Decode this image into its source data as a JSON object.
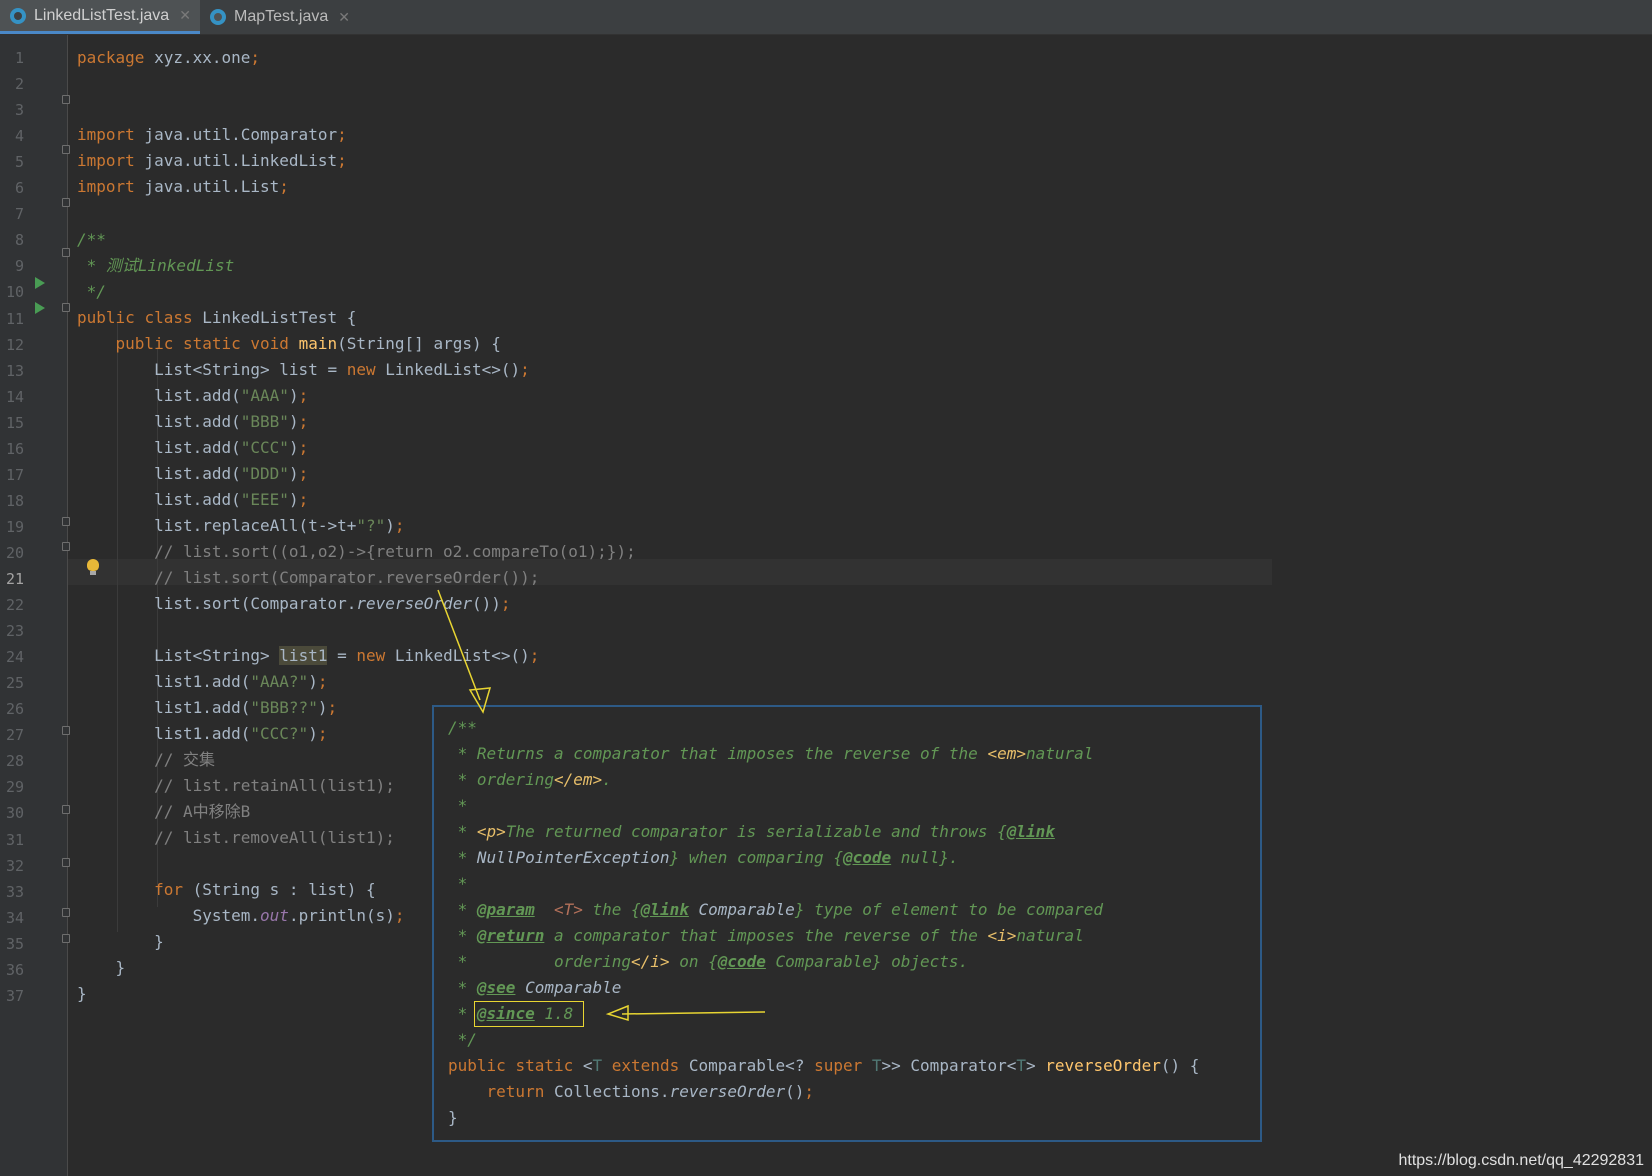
{
  "tabs": [
    {
      "label": "LinkedListTest.java",
      "active": true
    },
    {
      "label": "MapTest.java",
      "active": false
    }
  ],
  "current_line": 21,
  "line_numbers": [
    "1",
    "2",
    "3",
    "4",
    "5",
    "6",
    "7",
    "8",
    "9",
    "10",
    "11",
    "12",
    "13",
    "14",
    "15",
    "16",
    "17",
    "18",
    "19",
    "20",
    "21",
    "22",
    "23",
    "24",
    "25",
    "26",
    "27",
    "28",
    "29",
    "30",
    "31",
    "32",
    "33",
    "34",
    "35",
    "36",
    "37"
  ],
  "code": {
    "l1_kw": "package",
    "l1_rest": " xyz.xx.one",
    "semi": ";",
    "import_kw": "import",
    "l3": " java.util.Comparator",
    "l4": " java.util.LinkedList",
    "l5": " java.util.List",
    "l7": "/**",
    "l8": " * 测试LinkedList",
    "l9": " */",
    "public": "public",
    "class": "class",
    "static": "static",
    "void": "void",
    "l10_name": " LinkedListTest {",
    "main": "main",
    "l11_args": "(String[] args) {",
    "l12_a": "List<String> list = ",
    "new": "new",
    "l12_b": " LinkedList<>()",
    "add": "list.add(",
    "add1": "list1.add(",
    "s_aaa": "\"AAA\"",
    "s_bbb": "\"BBB\"",
    "s_ccc": "\"CCC\"",
    "s_ddd": "\"DDD\"",
    "s_eee": "\"EEE\"",
    "close": ")",
    "l18_a": "list.replaceAll(t->t+",
    "s_q": "\"?\"",
    "l19": "// list.sort((o1,o2)->{return o2.compareTo(o1);});",
    "l20": "// list.sort(Comparator.reverseOrder());",
    "l21_a": "list.sort(Comparator.",
    "reverseOrder": "reverseOrder",
    "l21_b": "())",
    "l23_a": "List<String> ",
    "list1": "list1",
    "l23_b": " = ",
    "l23_c": " LinkedList<>()",
    "s_aaa2": "\"AAA?\"",
    "s_bbb2": "\"BBB??\"",
    "s_ccc2": "\"CCC?\"",
    "l27": "// 交集",
    "l28": "// list.retainAll(list1);",
    "l29": "// A中移除B",
    "l30": "// list.removeAll(list1);",
    "for": "for",
    "l32_b": " (String s : list) {",
    "l33_a": "System.",
    "out": "out",
    "l33_b": ".println(s)",
    "brace": "}"
  },
  "popup": {
    "p1": "/**",
    "p2": " * Returns a comparator that imposes the reverse of the ",
    "em_open": "<em>",
    "p2b": "natural",
    "p3": " * ordering",
    "em_close": "</em>",
    "p3b": ".",
    "p4": " *",
    "p5": " * ",
    "p_tag": "<p>",
    "p5b": "The returned comparator is serializable and throws {",
    "link": "@link",
    "p6": " * ",
    "npe": "NullPointerException",
    "p6b": "} when comparing {",
    "code": "@code",
    "p6c": " null}.",
    "p7": " *",
    "p8": " * ",
    "param": "@param",
    "p8_t": "  <T>",
    "p8b": " the {",
    "comparable": "Comparable",
    "p8c": "} type of element to be compared",
    "p9": " * ",
    "return": "@return",
    "p9b": " a comparator that imposes the reverse of the ",
    "i_open": "<i>",
    "p9c": "natural",
    "p10": " *         ordering",
    "i_close": "</i>",
    "p10b": " on {",
    "p10c": " Comparable} objects.",
    "p11": " * ",
    "see": "@see",
    "p11b": " Comparable",
    "p12": " * ",
    "since": "@since",
    "p12b": " 1.8",
    "p13": " */",
    "p14_a": " <",
    "T": "T",
    "extends": "extends",
    "p14_b": " Comparable<? ",
    "super": "super",
    "p14_c": " T",
    "p14_d": ">> Comparator<",
    "p14_e": "T",
    "p14_f": "> ",
    "p14_fn": "reverseOrder",
    "p14_g": "() {",
    "return_kw": "return",
    "p15": " Collections.",
    "p15_fn": "reverseOrder",
    "p15_b": "()",
    "p16": "}"
  },
  "watermark": "https://blog.csdn.net/qq_42292831",
  "colors": {
    "keyword": "#cc7832",
    "string": "#6a8759",
    "comment": "#808080",
    "doc": "#629755",
    "function": "#ffc66d",
    "annotation": "#e8d532"
  }
}
